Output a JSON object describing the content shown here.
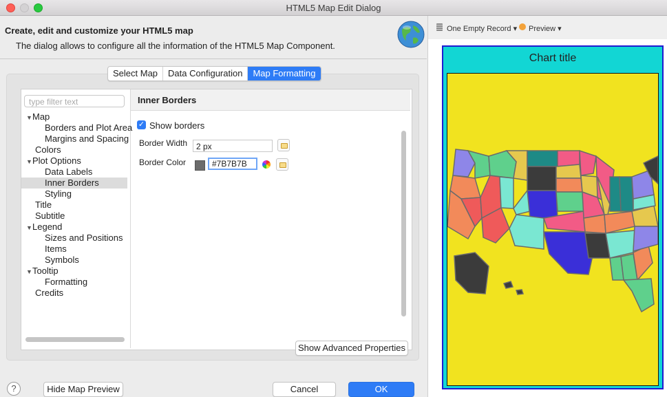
{
  "window": {
    "title": "HTML5 Map Edit Dialog"
  },
  "header": {
    "title": "Create, edit and customize your HTML5 map",
    "description": "The dialog allows to configure all the information of the HTML5 Map Component."
  },
  "tabs": [
    {
      "label": "Select Map",
      "active": false
    },
    {
      "label": "Data Configuration",
      "active": false
    },
    {
      "label": "Map Formatting",
      "active": true
    }
  ],
  "tree": {
    "filter_placeholder": "type filter text",
    "items": [
      {
        "label": "Map",
        "expanded": true,
        "level": 0
      },
      {
        "label": "Borders and Plot Area",
        "level": 1
      },
      {
        "label": "Margins and Spacing",
        "level": 1
      },
      {
        "label": "Colors",
        "level": 0
      },
      {
        "label": "Plot Options",
        "expanded": true,
        "level": 0
      },
      {
        "label": "Data Labels",
        "level": 1
      },
      {
        "label": "Inner Borders",
        "level": 1,
        "selected": true
      },
      {
        "label": "Styling",
        "level": 1
      },
      {
        "label": "Title",
        "level": 0
      },
      {
        "label": "Subtitle",
        "level": 0
      },
      {
        "label": "Legend",
        "expanded": true,
        "level": 0
      },
      {
        "label": "Sizes and Positions",
        "level": 1
      },
      {
        "label": "Items",
        "level": 1
      },
      {
        "label": "Symbols",
        "level": 1
      },
      {
        "label": "Tooltip",
        "expanded": true,
        "level": 0
      },
      {
        "label": "Formatting",
        "level": 1
      },
      {
        "label": "Credits",
        "level": 0
      }
    ]
  },
  "props": {
    "section_title": "Inner Borders",
    "show_borders_label": "Show borders",
    "show_borders_checked": true,
    "border_width_label": "Border Width",
    "border_width_value": "2 px",
    "border_color_label": "Border Color",
    "border_color_value": "#7B7B7B",
    "border_color_swatch": "#6b6b6b"
  },
  "buttons": {
    "advanced": "Show Advanced Properties",
    "hide_preview": "Hide Map Preview",
    "cancel": "Cancel",
    "ok": "OK",
    "help": "?"
  },
  "preview": {
    "record_label": "One Empty Record ▾",
    "preview_label": "Preview ▾",
    "chart_title": "Chart title",
    "colors": {
      "frame": "#12d6d4",
      "plot": "#f1e31f",
      "border": "#1f1ad2"
    }
  }
}
